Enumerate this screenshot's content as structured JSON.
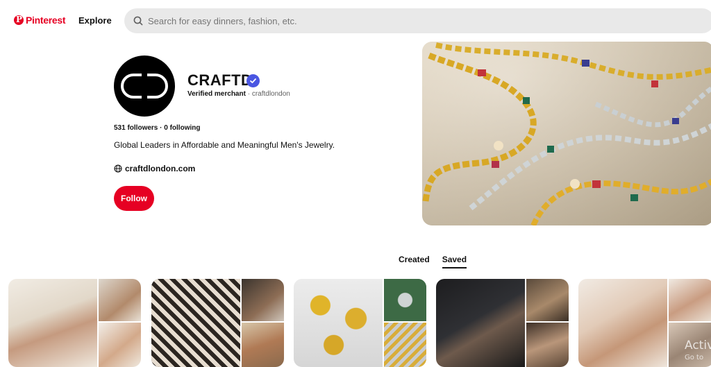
{
  "header": {
    "logo_text": "Pinterest",
    "explore_label": "Explore",
    "search_placeholder": "Search for easy dinners, fashion, etc."
  },
  "profile": {
    "name": "CRAFTD",
    "verified_label": "Verified merchant",
    "separator": " · ",
    "handle": "craftdlondon",
    "followers_text": "531 followers · 0 following",
    "bio": "Global Leaders in Affordable and Meaningful Men's Jewelry.",
    "website": "craftdlondon.com",
    "follow_label": "Follow"
  },
  "tabs": [
    {
      "label": "Created",
      "active": false
    },
    {
      "label": "Saved",
      "active": true
    }
  ],
  "overlay": {
    "line1": "Activ",
    "line2": "Go to"
  },
  "colors": {
    "brand_red": "#e60023",
    "verified_blue": "#4a56e2"
  }
}
